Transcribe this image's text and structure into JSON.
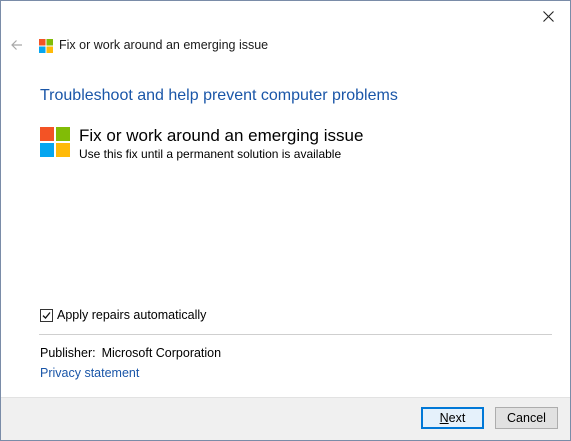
{
  "window": {
    "title": "Fix or work around an emerging issue"
  },
  "main": {
    "heading": "Troubleshoot and help prevent computer problems",
    "issue_title": "Fix or work around an emerging issue",
    "issue_subtitle": "Use this fix until a permanent solution is available"
  },
  "options": {
    "apply_repairs_label": "Apply repairs automatically",
    "apply_repairs_checked": true
  },
  "publisher": {
    "label": "Publisher:",
    "value": "Microsoft Corporation"
  },
  "links": {
    "privacy": "Privacy statement"
  },
  "buttons": {
    "next_first": "N",
    "next_rest": "ext",
    "cancel": "Cancel"
  },
  "colors": {
    "accent": "#1a56a8",
    "logo_red": "#f35325",
    "logo_green": "#81bc06",
    "logo_blue": "#05a6f0",
    "logo_yellow": "#ffba08"
  },
  "icons": [
    "close-icon",
    "back-arrow-icon",
    "microsoft-logo-icon",
    "checkmark-icon"
  ]
}
